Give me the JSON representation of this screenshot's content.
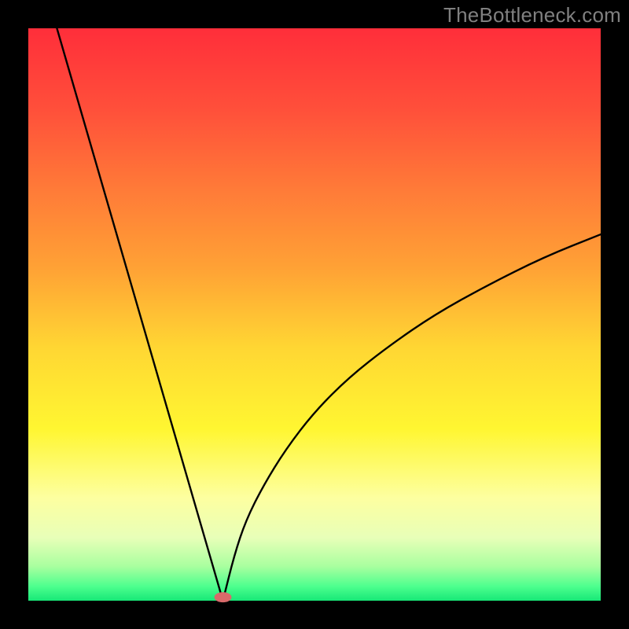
{
  "watermark": "TheBottleneck.com",
  "chart_data": {
    "type": "line",
    "title": "",
    "xlabel": "",
    "ylabel": "",
    "xlim": [
      0,
      100
    ],
    "ylim": [
      0,
      100
    ],
    "grid": false,
    "legend": false,
    "gradient_stops": [
      {
        "offset": 0.0,
        "color": "#ff2e3a"
      },
      {
        "offset": 0.14,
        "color": "#ff4f3a"
      },
      {
        "offset": 0.28,
        "color": "#ff7a38"
      },
      {
        "offset": 0.42,
        "color": "#ffa235"
      },
      {
        "offset": 0.56,
        "color": "#ffd733"
      },
      {
        "offset": 0.7,
        "color": "#fff631"
      },
      {
        "offset": 0.82,
        "color": "#fdffa0"
      },
      {
        "offset": 0.89,
        "color": "#e8ffb8"
      },
      {
        "offset": 0.94,
        "color": "#a9ff9f"
      },
      {
        "offset": 0.975,
        "color": "#4dff8e"
      },
      {
        "offset": 1.0,
        "color": "#17e877"
      }
    ],
    "curve": {
      "description": "V-shaped bottleneck curve — steep linear descent on the left, minimum around x≈34, sqrt-like rise on the right",
      "minimum_x": 34,
      "left": [
        {
          "x": 5.0,
          "y": 100.0
        },
        {
          "x": 34.0,
          "y": 0.0
        }
      ],
      "right": [
        {
          "x": 34.0,
          "y": 0.0
        },
        {
          "x": 36.0,
          "y": 8.0
        },
        {
          "x": 38.0,
          "y": 14.0
        },
        {
          "x": 41.0,
          "y": 20.0
        },
        {
          "x": 45.0,
          "y": 26.5
        },
        {
          "x": 50.0,
          "y": 33.0
        },
        {
          "x": 56.0,
          "y": 39.0
        },
        {
          "x": 63.0,
          "y": 44.5
        },
        {
          "x": 71.0,
          "y": 50.0
        },
        {
          "x": 80.0,
          "y": 55.0
        },
        {
          "x": 90.0,
          "y": 60.0
        },
        {
          "x": 100.0,
          "y": 64.0
        }
      ],
      "stroke": "#000000",
      "stroke_width": 2.4
    },
    "marker": {
      "x": 34,
      "y": 0.6,
      "rx": 1.5,
      "ry": 0.9,
      "color": "#d86a6a"
    },
    "background": "#000000",
    "plot_margin_pct": {
      "left": 4.5,
      "right": 4.5,
      "top": 4.5,
      "bottom": 4.5
    }
  }
}
